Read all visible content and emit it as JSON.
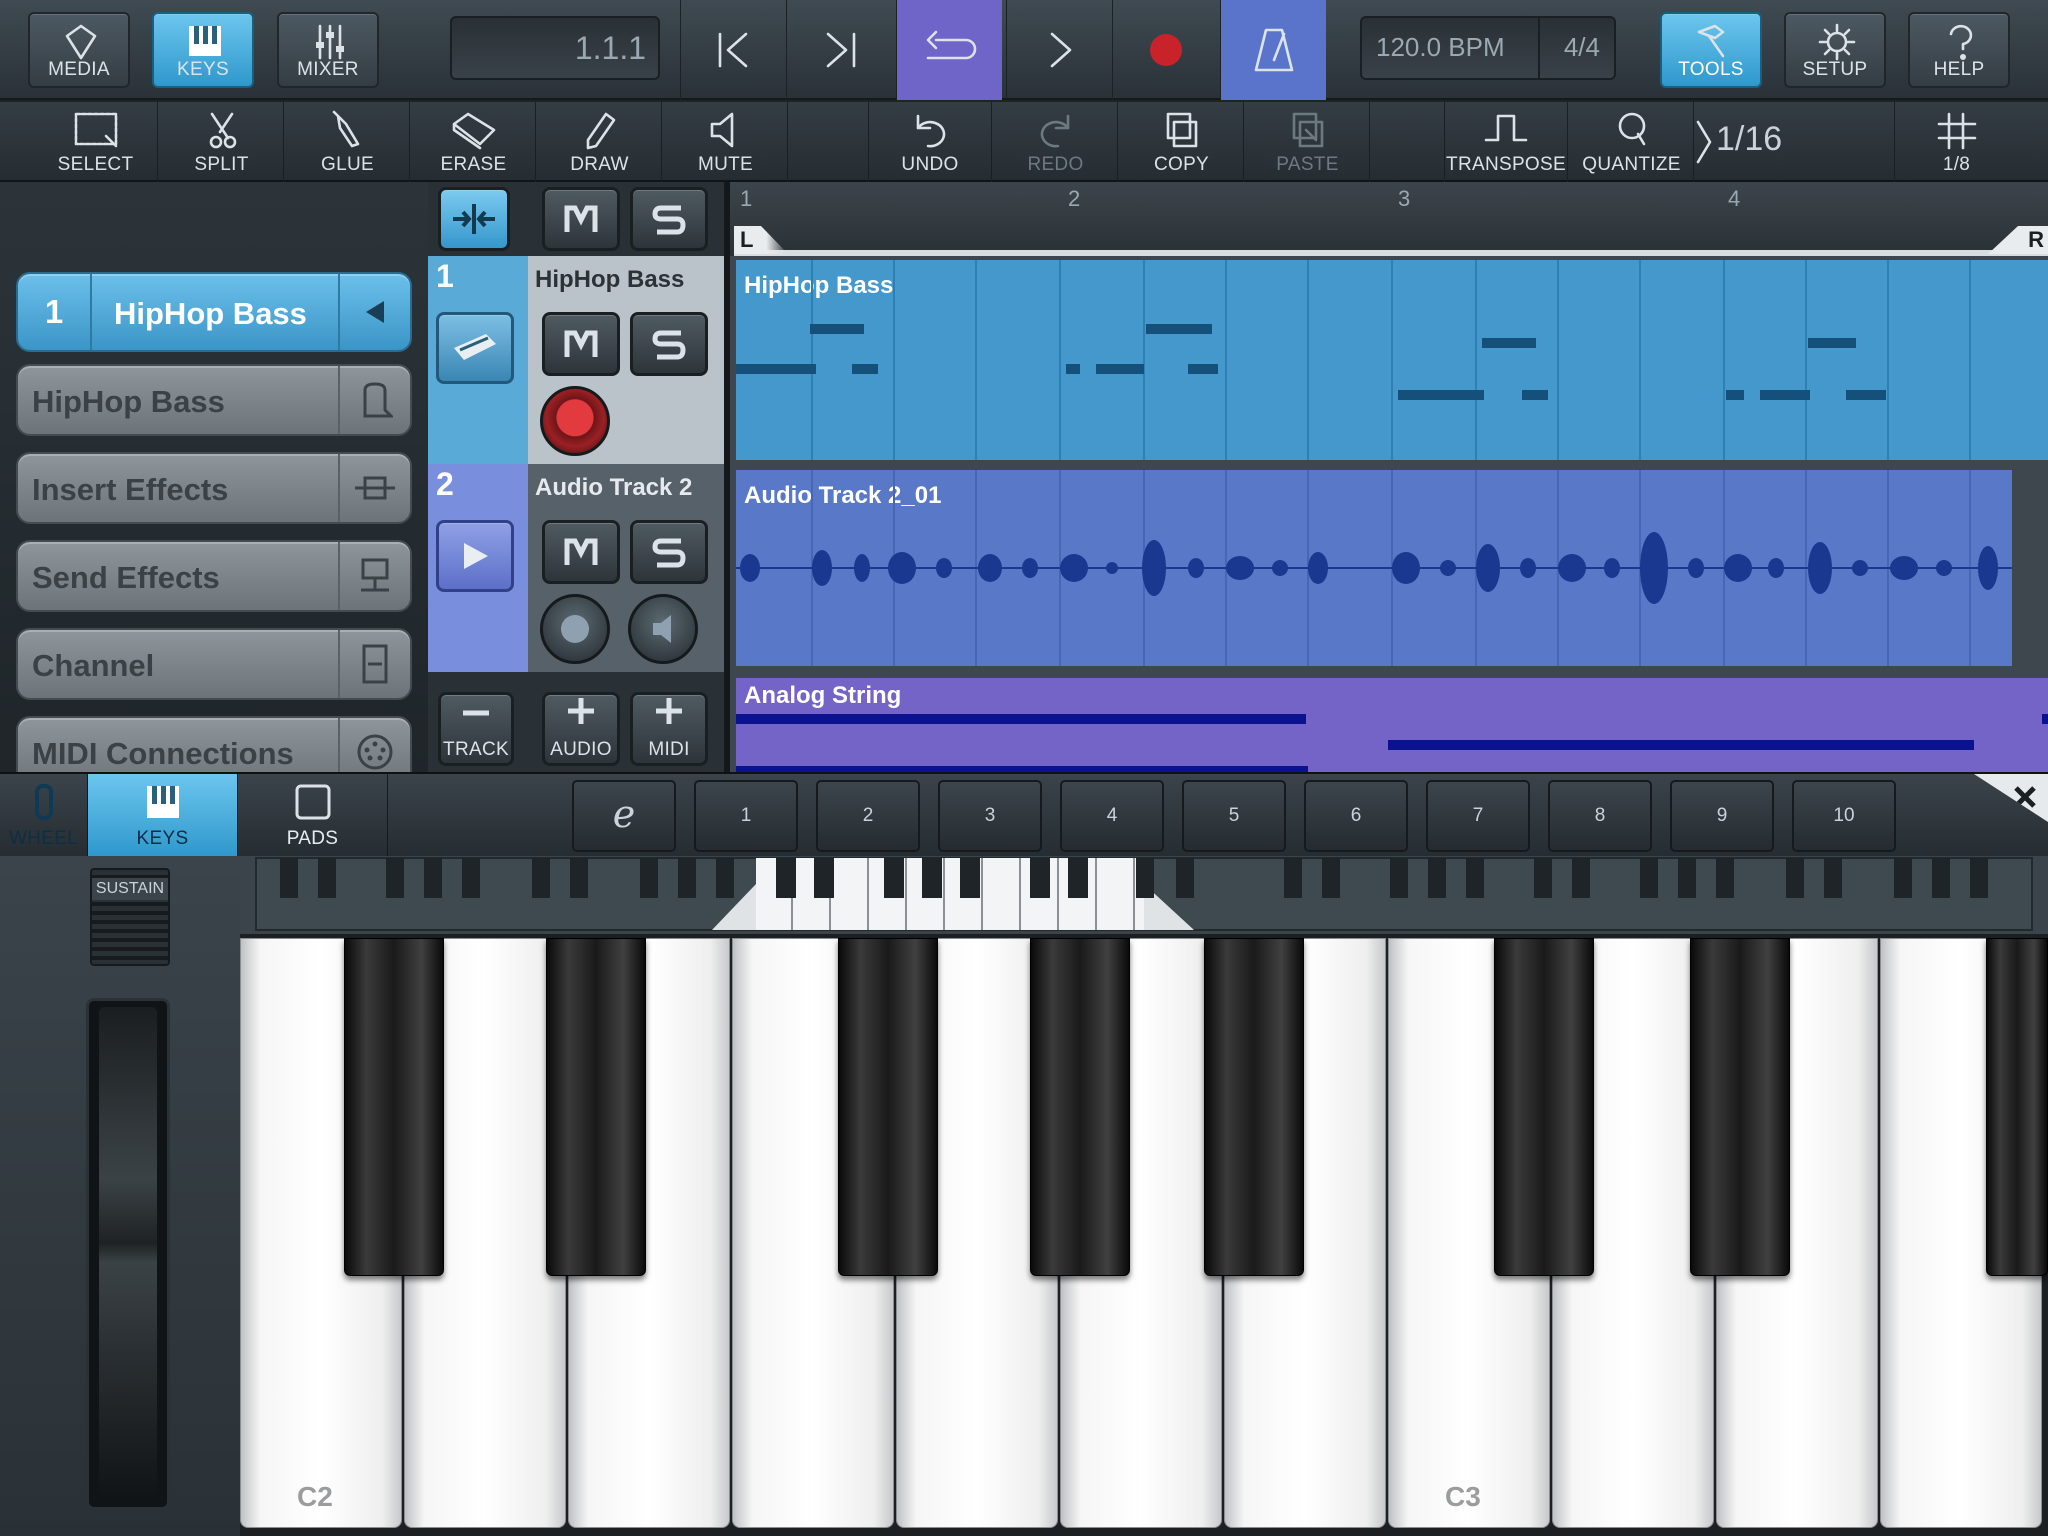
{
  "top": {
    "media": "MEDIA",
    "keys": "KEYS",
    "mixer": "MIXER",
    "position": "1.1.1",
    "tempo": "120.0 BPM",
    "signature": "4/4",
    "tools": "TOOLS",
    "setup": "SETUP",
    "help": "HELP"
  },
  "toolbar": {
    "select": "SELECT",
    "split": "SPLIT",
    "glue": "GLUE",
    "erase": "ERASE",
    "draw": "DRAW",
    "mute": "MUTE",
    "undo": "UNDO",
    "redo": "REDO",
    "copy": "COPY",
    "paste": "PASTE",
    "transpose": "TRANSPOSE",
    "quantize": "QUANTIZE",
    "quantize_value": "1/16",
    "grid_value": "1/8"
  },
  "inspector": {
    "track_number": "1",
    "track_name": "HipHop Bass",
    "instrument": "HipHop Bass",
    "insert": "Insert Effects",
    "send": "Send Effects",
    "channel": "Channel",
    "midi": "MIDI Connections"
  },
  "tracks": [
    {
      "number": "1",
      "name": "HipHop Bass"
    },
    {
      "number": "2",
      "name": "Audio Track 2"
    }
  ],
  "track_buttons": {
    "track": "TRACK",
    "audio": "AUDIO",
    "midi": "MIDI"
  },
  "ruler": {
    "bars": [
      "1",
      "2",
      "3",
      "4"
    ],
    "left": "L",
    "right": "R"
  },
  "clips": {
    "c1": "HipHop Bass",
    "c2": "Audio Track 2_01",
    "c3": "Analog String"
  },
  "keyboard": {
    "wheel": "WHEEL",
    "keys": "KEYS",
    "pads": "PADS",
    "e": "e",
    "slots": [
      "1",
      "2",
      "3",
      "4",
      "5",
      "6",
      "7",
      "8",
      "9",
      "10"
    ],
    "sustain": "SUSTAIN",
    "c2": "C2",
    "c3": "C3"
  },
  "colors": {
    "accent": "#3b9bd0",
    "midi_clip": "#4598cc",
    "audio_clip": "#5a78c8",
    "string_clip": "#7464c8"
  }
}
